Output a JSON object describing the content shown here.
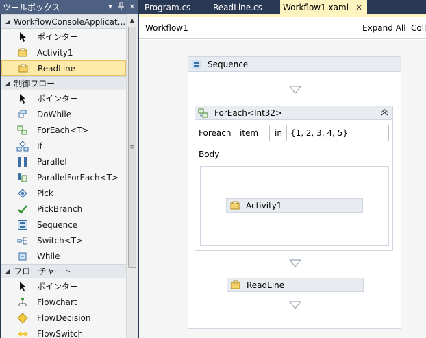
{
  "toolbox": {
    "title": "ツールボックス",
    "pin_icon": "pin-icon",
    "close_icon": "close-icon",
    "categories": [
      {
        "label": "WorkflowConsoleApplicat...",
        "items": [
          {
            "label": "ポインター",
            "icon": "pointer-icon"
          },
          {
            "label": "Activity1",
            "icon": "activity-icon"
          },
          {
            "label": "ReadLine",
            "icon": "activity-icon",
            "selected": true
          }
        ]
      },
      {
        "label": "制御フロー",
        "items": [
          {
            "label": "ポインター",
            "icon": "pointer-icon"
          },
          {
            "label": "DoWhile",
            "icon": "dowhile-icon"
          },
          {
            "label": "ForEach<T>",
            "icon": "foreach-icon"
          },
          {
            "label": "If",
            "icon": "if-icon"
          },
          {
            "label": "Parallel",
            "icon": "parallel-icon"
          },
          {
            "label": "ParallelForEach<T>",
            "icon": "parallel-foreach-icon"
          },
          {
            "label": "Pick",
            "icon": "pick-icon"
          },
          {
            "label": "PickBranch",
            "icon": "pickbranch-icon"
          },
          {
            "label": "Sequence",
            "icon": "sequence-icon"
          },
          {
            "label": "Switch<T>",
            "icon": "switch-icon"
          },
          {
            "label": "While",
            "icon": "while-icon"
          }
        ]
      },
      {
        "label": "フローチャート",
        "items": [
          {
            "label": "ポインター",
            "icon": "pointer-icon"
          },
          {
            "label": "Flowchart",
            "icon": "flowchart-icon"
          },
          {
            "label": "FlowDecision",
            "icon": "flowdecision-icon"
          },
          {
            "label": "FlowSwitch",
            "icon": "flowswitch-icon"
          }
        ]
      }
    ]
  },
  "tabs": [
    {
      "label": "Program.cs",
      "active": false
    },
    {
      "label": "ReadLine.cs",
      "active": false
    },
    {
      "label": "Workflow1.xaml",
      "active": true,
      "close": "✕"
    }
  ],
  "designer": {
    "breadcrumb": "Workflow1",
    "expand_all": "Expand All",
    "collapse_all": "Coll",
    "sequence": {
      "title": "Sequence",
      "foreach": {
        "title": "ForEach<Int32>",
        "foreach_label": "Foreach",
        "item_value": "item",
        "in_label": "in",
        "values_expression": "{1, 2, 3, 4, 5}",
        "body_label": "Body",
        "body_activity": "Activity1"
      },
      "readline_activity": "ReadLine"
    }
  },
  "colors": {
    "chrome": "#293955",
    "active_tab": "#fdf4bf",
    "selection": "#fde9a8",
    "activity_header": "#e8ebef"
  }
}
